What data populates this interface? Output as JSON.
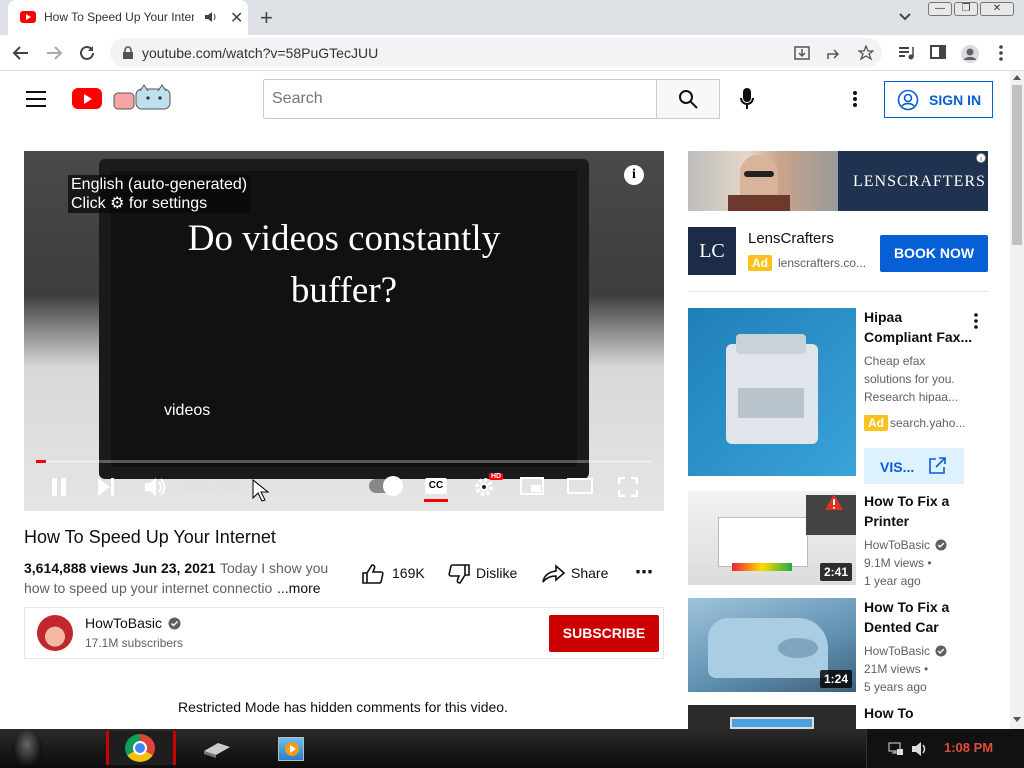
{
  "browser": {
    "tab_title": "How To Speed Up Your Internet",
    "url": "youtube.com/watch?v=58PuGTecJUU",
    "new_tab_label": "+",
    "close_tab_label": "✕"
  },
  "header": {
    "search_placeholder": "Search",
    "signin_label": "SIGN IN"
  },
  "player": {
    "cc_notice_line1": "English (auto-generated)",
    "cc_notice_line2": "Click ⚙ for settings",
    "info_label": "i",
    "screen_text_line1": "Do videos constantly",
    "screen_text_line2": "buffer?",
    "caption": "videos",
    "time": "0:03 / 3:11",
    "progress": 0.016,
    "cc_label": "CC",
    "hd_label": "HD"
  },
  "video": {
    "title": "How To Speed Up Your Internet",
    "views_date": "3,614,888 views  Jun 23, 2021",
    "description_line1": "Today I show you",
    "description_line2": "how to speed up your internet connectio",
    "more_label": "...more",
    "likes": "169K",
    "dislike_label": "Dislike",
    "share_label": "Share",
    "more_actions": "⋯",
    "channel": "HowToBasic",
    "subscribers": "17.1M subscribers",
    "subscribe_label": "SUBSCRIBE",
    "restricted_notice": "Restricted Mode has hidden comments for this video."
  },
  "sidebar": {
    "ad_banner_brand": "LENSCRAFTERS",
    "ad_logo": "LC",
    "ad_name": "LensCrafters",
    "ad_badge": "Ad",
    "ad_url": "lenscrafters.co...",
    "book_now_label": "BOOK NOW",
    "promo": {
      "title": "Hipaa Compliant Fax...",
      "desc": "Cheap efax solutions for you. Research hipaa...",
      "badge": "Ad",
      "source": "search.yaho...",
      "visit_label": "VIS..."
    },
    "items": [
      {
        "title": "How To Fix a Printer",
        "channel": "HowToBasic",
        "views": "9.1M views •",
        "age": "1 year ago",
        "duration": "2:41"
      },
      {
        "title": "How To Fix a Dented Car",
        "channel": "HowToBasic",
        "views": "21M views •",
        "age": "5 years ago",
        "duration": "1:24"
      },
      {
        "title": "How To",
        "channel": "",
        "views": "",
        "age": "",
        "duration": ""
      }
    ]
  },
  "taskbar": {
    "clock": "1:08 PM"
  },
  "colors": {
    "youtube_red": "#ff0000",
    "link_blue": "#065fd4",
    "subscribe_red": "#cc0000",
    "ad_yellow": "#fcc21b"
  }
}
